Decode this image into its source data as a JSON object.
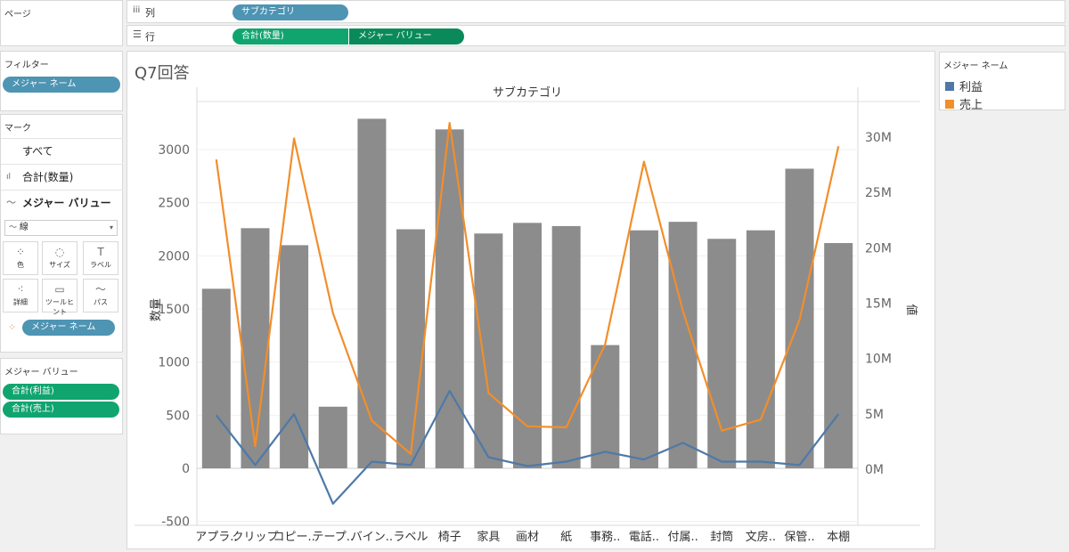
{
  "shelves": {
    "pages_label": "ページ",
    "columns_label": "列",
    "columns_pill": "サブカテゴリ",
    "rows_label": "行",
    "rows_pills": [
      "合計(数量)",
      "メジャー バリュー"
    ]
  },
  "filters": {
    "title": "フィルター",
    "pill": "メジャー ネーム"
  },
  "marks": {
    "title": "マーク",
    "all": "すべて",
    "sum_qty": "合計(数量)",
    "measure_values": "メジャー バリュー",
    "mark_type": "線",
    "buttons": [
      "色",
      "サイズ",
      "ラベル",
      "詳細",
      "ツールヒント",
      "パス"
    ],
    "color_pill": "メジャー ネーム"
  },
  "measure_values_card": {
    "title": "メジャー バリュー",
    "pills": [
      "合計(利益)",
      "合計(売上)"
    ]
  },
  "legend": {
    "title": "メジャー ネーム",
    "items": [
      {
        "label": "利益",
        "color": "#4e79a7"
      },
      {
        "label": "売上",
        "color": "#f28e2b"
      }
    ]
  },
  "chart_data": {
    "type": "bar+line",
    "title": "Q7回答",
    "header": "サブカテゴリ",
    "categories": [
      "アプラ..",
      "クリップ",
      "コピー..",
      "テープ..",
      "バイン..",
      "ラベル",
      "椅子",
      "家具",
      "画材",
      "紙",
      "事務..",
      "電話..",
      "付属..",
      "封筒",
      "文房..",
      "保管..",
      "本棚"
    ],
    "bar_series": {
      "name": "数量",
      "color": "#8c8c8c",
      "values": [
        1690,
        2260,
        2100,
        580,
        3290,
        2250,
        3190,
        2210,
        2310,
        2280,
        1160,
        2240,
        2320,
        2160,
        2240,
        2820,
        2120
      ]
    },
    "line_series": [
      {
        "name": "利益",
        "color": "#4e79a7",
        "values": [
          4.8,
          0.3,
          4.9,
          -3.2,
          0.6,
          0.3,
          7.0,
          1.0,
          0.2,
          0.6,
          1.5,
          0.8,
          2.3,
          0.6,
          0.6,
          0.3,
          4.9
        ]
      },
      {
        "name": "売上",
        "color": "#f28e2b",
        "values": [
          27.9,
          2.0,
          29.8,
          14.0,
          4.3,
          1.3,
          31.2,
          6.8,
          3.8,
          3.7,
          11.2,
          27.7,
          14.2,
          3.4,
          4.4,
          13.4,
          29.1
        ]
      }
    ],
    "ylabel_left": "数量",
    "ylim_left": [
      -500,
      3300
    ],
    "yticks_left": [
      -500,
      0,
      500,
      1000,
      1500,
      2000,
      2500,
      3000
    ],
    "ylabel_right": "値",
    "ylim_right_millions": [
      -4.0,
      32.8
    ],
    "yticks_right": [
      {
        "v": 0,
        "label": "0M"
      },
      {
        "v": 5,
        "label": "5M"
      },
      {
        "v": 10,
        "label": "10M"
      },
      {
        "v": 15,
        "label": "15M"
      },
      {
        "v": 20,
        "label": "20M"
      },
      {
        "v": 25,
        "label": "25M"
      },
      {
        "v": 30,
        "label": "30M"
      }
    ]
  }
}
